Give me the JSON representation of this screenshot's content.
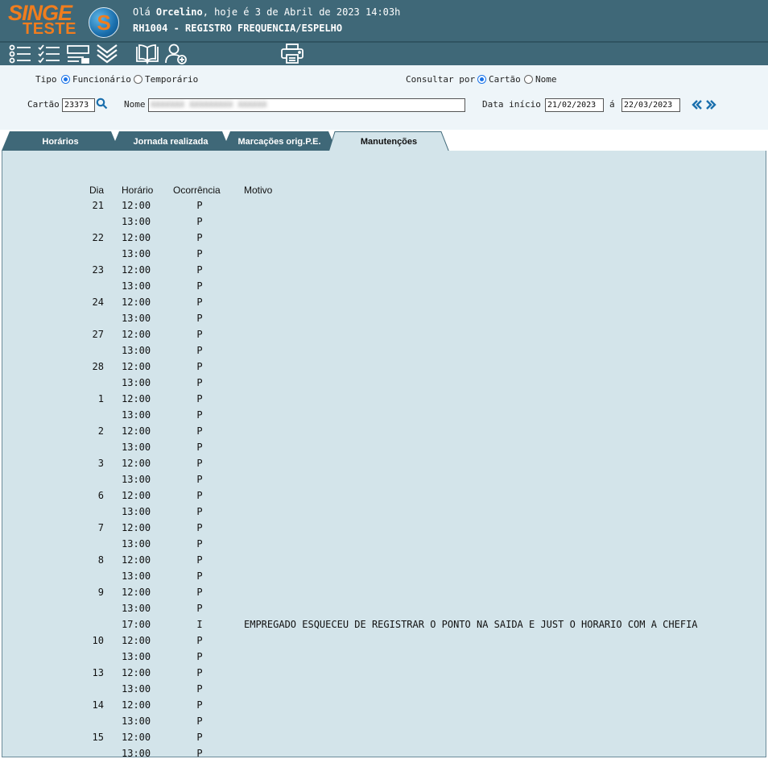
{
  "header": {
    "logo_main": "SINGE",
    "logo_sub": "TESTE",
    "logo_badge": "S",
    "greeting_prefix": "Olá ",
    "user": "Orcelino",
    "greeting_suffix": ", hoje é 3 de Abril de 2023 14:03h",
    "module": "RH1004 - REGISTRO FREQUENCIA/ESPELHO"
  },
  "toolbar": {
    "icons": [
      "list-icon",
      "checklist-icon",
      "form-icon",
      "expand-icon",
      "book-icon",
      "add-user-icon",
      "print-icon"
    ]
  },
  "filter": {
    "tipo_label": "Tipo",
    "tipo_options": [
      "Funcionário",
      "Temporário"
    ],
    "tipo_selected": "Funcionário",
    "consultar_label": "Consultar por",
    "consultar_options": [
      "Cartão",
      "Nome"
    ],
    "consultar_selected": "Cartão",
    "cartao_label": "Cartão",
    "cartao_value": "23373",
    "nome_label": "Nome",
    "nome_value": "XXXXXXX XXXXXXXXX XXXXXX",
    "data_inicio_label": "Data início",
    "data_inicio_value": "21/02/2023",
    "a_label": "á",
    "data_fim_value": "22/03/2023",
    "accent": "#1a73e8"
  },
  "tabs": [
    {
      "label": "Horários",
      "active": false
    },
    {
      "label": "Jornada realizada",
      "active": false
    },
    {
      "label": "Marcações orig.P.E.",
      "active": false
    },
    {
      "label": "Manutenções",
      "active": true
    }
  ],
  "table": {
    "headers": {
      "dia": "Dia",
      "horario": "Horário",
      "ocorrencia": "Ocorrência",
      "motivo": "Motivo"
    },
    "rows": [
      {
        "dia": "21",
        "horario": "12:00",
        "ocorrencia": "P",
        "motivo": ""
      },
      {
        "dia": "",
        "horario": "13:00",
        "ocorrencia": "P",
        "motivo": ""
      },
      {
        "dia": "22",
        "horario": "12:00",
        "ocorrencia": "P",
        "motivo": ""
      },
      {
        "dia": "",
        "horario": "13:00",
        "ocorrencia": "P",
        "motivo": ""
      },
      {
        "dia": "23",
        "horario": "12:00",
        "ocorrencia": "P",
        "motivo": ""
      },
      {
        "dia": "",
        "horario": "13:00",
        "ocorrencia": "P",
        "motivo": ""
      },
      {
        "dia": "24",
        "horario": "12:00",
        "ocorrencia": "P",
        "motivo": ""
      },
      {
        "dia": "",
        "horario": "13:00",
        "ocorrencia": "P",
        "motivo": ""
      },
      {
        "dia": "27",
        "horario": "12:00",
        "ocorrencia": "P",
        "motivo": ""
      },
      {
        "dia": "",
        "horario": "13:00",
        "ocorrencia": "P",
        "motivo": ""
      },
      {
        "dia": "28",
        "horario": "12:00",
        "ocorrencia": "P",
        "motivo": ""
      },
      {
        "dia": "",
        "horario": "13:00",
        "ocorrencia": "P",
        "motivo": ""
      },
      {
        "dia": "1",
        "horario": "12:00",
        "ocorrencia": "P",
        "motivo": ""
      },
      {
        "dia": "",
        "horario": "13:00",
        "ocorrencia": "P",
        "motivo": ""
      },
      {
        "dia": "2",
        "horario": "12:00",
        "ocorrencia": "P",
        "motivo": ""
      },
      {
        "dia": "",
        "horario": "13:00",
        "ocorrencia": "P",
        "motivo": ""
      },
      {
        "dia": "3",
        "horario": "12:00",
        "ocorrencia": "P",
        "motivo": ""
      },
      {
        "dia": "",
        "horario": "13:00",
        "ocorrencia": "P",
        "motivo": ""
      },
      {
        "dia": "6",
        "horario": "12:00",
        "ocorrencia": "P",
        "motivo": ""
      },
      {
        "dia": "",
        "horario": "13:00",
        "ocorrencia": "P",
        "motivo": ""
      },
      {
        "dia": "7",
        "horario": "12:00",
        "ocorrencia": "P",
        "motivo": ""
      },
      {
        "dia": "",
        "horario": "13:00",
        "ocorrencia": "P",
        "motivo": ""
      },
      {
        "dia": "8",
        "horario": "12:00",
        "ocorrencia": "P",
        "motivo": ""
      },
      {
        "dia": "",
        "horario": "13:00",
        "ocorrencia": "P",
        "motivo": ""
      },
      {
        "dia": "9",
        "horario": "12:00",
        "ocorrencia": "P",
        "motivo": ""
      },
      {
        "dia": "",
        "horario": "13:00",
        "ocorrencia": "P",
        "motivo": ""
      },
      {
        "dia": "",
        "horario": "17:00",
        "ocorrencia": "I",
        "motivo": "EMPREGADO ESQUECEU DE REGISTRAR O PONTO NA SAIDA E JUST O HORARIO COM A CHEFIA"
      },
      {
        "dia": "10",
        "horario": "12:00",
        "ocorrencia": "P",
        "motivo": ""
      },
      {
        "dia": "",
        "horario": "13:00",
        "ocorrencia": "P",
        "motivo": ""
      },
      {
        "dia": "13",
        "horario": "12:00",
        "ocorrencia": "P",
        "motivo": ""
      },
      {
        "dia": "",
        "horario": "13:00",
        "ocorrencia": "P",
        "motivo": ""
      },
      {
        "dia": "14",
        "horario": "12:00",
        "ocorrencia": "P",
        "motivo": ""
      },
      {
        "dia": "",
        "horario": "13:00",
        "ocorrencia": "P",
        "motivo": ""
      },
      {
        "dia": "15",
        "horario": "12:00",
        "ocorrencia": "P",
        "motivo": ""
      },
      {
        "dia": "",
        "horario": "13:00",
        "ocorrencia": "P",
        "motivo": ""
      }
    ]
  },
  "colors": {
    "header_bg": "#3f6878",
    "content_bg": "#d3e4ea",
    "logo": "#f07d1e"
  }
}
